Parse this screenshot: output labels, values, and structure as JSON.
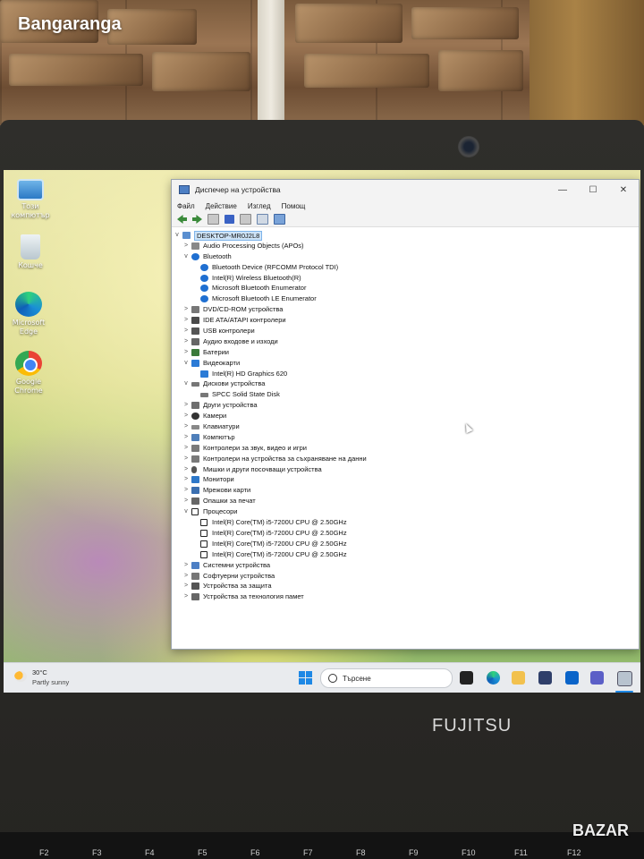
{
  "photo": {
    "watermark": "Bangaranga",
    "brand": "FUJITSU",
    "marketplace_logo": "BAZAR",
    "function_keys": [
      "F2",
      "F3",
      "F4",
      "F5",
      "F6",
      "F7",
      "F8",
      "F9",
      "F10",
      "F11",
      "F12"
    ]
  },
  "desktop": {
    "icons": [
      {
        "name": "this-pc",
        "label": "Този компютър",
        "icon": "computer-icon"
      },
      {
        "name": "recycle-bin",
        "label": "Кошче",
        "icon": "recycle-bin-icon"
      },
      {
        "name": "edge",
        "label": "Microsoft Edge",
        "icon": "edge-icon"
      },
      {
        "name": "chrome",
        "label": "Google Chrome",
        "icon": "chrome-icon"
      }
    ]
  },
  "window": {
    "title": "Диспечер на устройства",
    "controls": {
      "minimize": "—",
      "maximize": "☐",
      "close": "✕"
    },
    "menu": [
      "Файл",
      "Действие",
      "Изглед",
      "Помощ"
    ],
    "tree": [
      {
        "level": 0,
        "expander": "v",
        "label": "DESKTOP-MR0J2L8",
        "icon": "computer",
        "selected": true
      },
      {
        "level": 1,
        "expander": ">",
        "label": "Audio Processing Objects (APOs)",
        "icon": "audio"
      },
      {
        "level": 1,
        "expander": "v",
        "label": "Bluetooth",
        "icon": "bt"
      },
      {
        "level": 2,
        "expander": "",
        "label": "Bluetooth Device (RFCOMM Protocol TDI)",
        "icon": "bt"
      },
      {
        "level": 2,
        "expander": "",
        "label": "Intel(R) Wireless Bluetooth(R)",
        "icon": "bt"
      },
      {
        "level": 2,
        "expander": "",
        "label": "Microsoft Bluetooth Enumerator",
        "icon": "bt"
      },
      {
        "level": 2,
        "expander": "",
        "label": "Microsoft Bluetooth LE Enumerator",
        "icon": "bt"
      },
      {
        "level": 1,
        "expander": ">",
        "label": "DVD/CD-ROM устройства",
        "icon": "dvd"
      },
      {
        "level": 1,
        "expander": ">",
        "label": "IDE ATA/ATAPI контролери",
        "icon": "ide"
      },
      {
        "level": 1,
        "expander": ">",
        "label": "USB контролери",
        "icon": "usb"
      },
      {
        "level": 1,
        "expander": ">",
        "label": "Аудио входове и изходи",
        "icon": "sound"
      },
      {
        "level": 1,
        "expander": ">",
        "label": "Батерии",
        "icon": "battery"
      },
      {
        "level": 1,
        "expander": "v",
        "label": "Видеокарти",
        "icon": "display"
      },
      {
        "level": 2,
        "expander": "",
        "label": "Intel(R) HD Graphics 620",
        "icon": "display"
      },
      {
        "level": 1,
        "expander": "v",
        "label": "Дискови устройства",
        "icon": "disk"
      },
      {
        "level": 2,
        "expander": "",
        "label": "SPCC Solid State Disk",
        "icon": "disk"
      },
      {
        "level": 1,
        "expander": ">",
        "label": "Други устройства",
        "icon": "other"
      },
      {
        "level": 1,
        "expander": ">",
        "label": "Камери",
        "icon": "camera"
      },
      {
        "level": 1,
        "expander": ">",
        "label": "Клавиатури",
        "icon": "keyboard"
      },
      {
        "level": 1,
        "expander": ">",
        "label": "Компютър",
        "icon": "comp"
      },
      {
        "level": 1,
        "expander": ">",
        "label": "Контролери за звук, видео и игри",
        "icon": "ctrl"
      },
      {
        "level": 1,
        "expander": ">",
        "label": "Контролери на устройства за съхраняване на данни",
        "icon": "ctrl"
      },
      {
        "level": 1,
        "expander": ">",
        "label": "Мишки и други посочващи устройства",
        "icon": "mouse"
      },
      {
        "level": 1,
        "expander": ">",
        "label": "Монитори",
        "icon": "monitor"
      },
      {
        "level": 1,
        "expander": ">",
        "label": "Мрежови карти",
        "icon": "net"
      },
      {
        "level": 1,
        "expander": ">",
        "label": "Опашки за печат",
        "icon": "print"
      },
      {
        "level": 1,
        "expander": "v",
        "label": "Процесори",
        "icon": "cpu"
      },
      {
        "level": 2,
        "expander": "",
        "label": "Intel(R) Core(TM) i5-7200U CPU @ 2.50GHz",
        "icon": "cpu"
      },
      {
        "level": 2,
        "expander": "",
        "label": "Intel(R) Core(TM) i5-7200U CPU @ 2.50GHz",
        "icon": "cpu"
      },
      {
        "level": 2,
        "expander": "",
        "label": "Intel(R) Core(TM) i5-7200U CPU @ 2.50GHz",
        "icon": "cpu"
      },
      {
        "level": 2,
        "expander": "",
        "label": "Intel(R) Core(TM) i5-7200U CPU @ 2.50GHz",
        "icon": "cpu"
      },
      {
        "level": 1,
        "expander": ">",
        "label": "Системни устройства",
        "icon": "sys"
      },
      {
        "level": 1,
        "expander": ">",
        "label": "Софтуерни устройства",
        "icon": "soft"
      },
      {
        "level": 1,
        "expander": ">",
        "label": "Устройства за защита",
        "icon": "sec"
      },
      {
        "level": 1,
        "expander": ">",
        "label": "Устройства за технология памет",
        "icon": "mem"
      }
    ]
  },
  "taskbar": {
    "weather_temp": "30°C",
    "weather_desc": "Partly sunny",
    "search_placeholder": "Търсене"
  }
}
